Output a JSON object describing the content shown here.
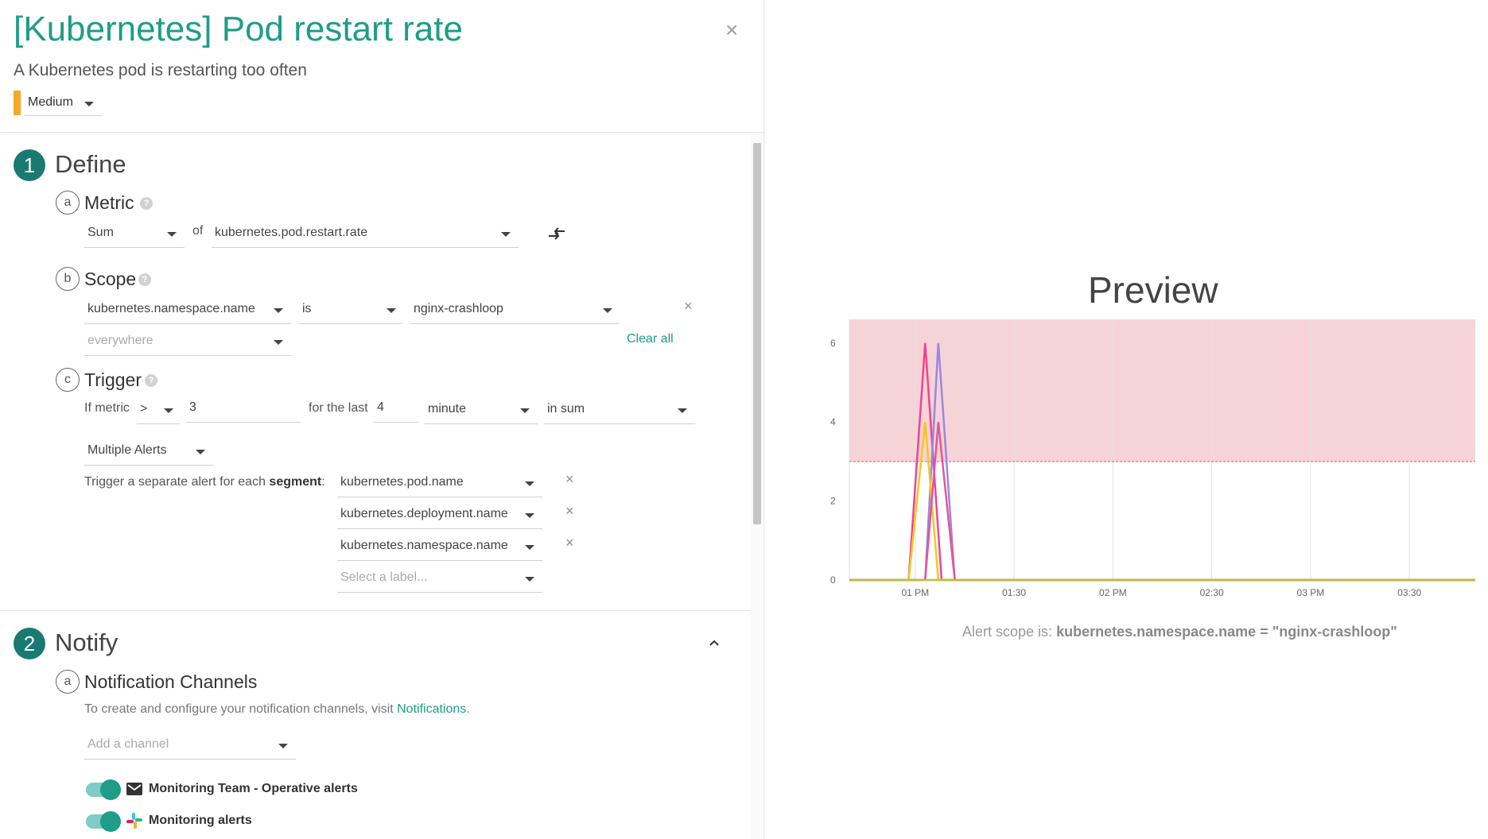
{
  "header": {
    "title": "[Kubernetes] Pod restart rate",
    "subtitle": "A Kubernetes pod is restarting too often",
    "severity": "Medium",
    "severity_color": "#f9a825",
    "close_icon": "close-icon"
  },
  "define": {
    "step_number": "1",
    "title": "Define",
    "metric": {
      "letter": "a",
      "label": "Metric",
      "help": "?",
      "aggregation": "Sum",
      "of_label": "of",
      "metric_name": "kubernetes.pod.restart.rate",
      "swap_icon": "swap-arrows-icon"
    },
    "scope": {
      "letter": "b",
      "label": "Scope",
      "help": "?",
      "key": "kubernetes.namespace.name",
      "operator": "is",
      "value": "nginx-crashloop",
      "second_placeholder": "everywhere",
      "clear_all": "Clear all"
    },
    "trigger": {
      "letter": "c",
      "label": "Trigger",
      "help": "?",
      "if_metric": "If metric",
      "comparator": ">",
      "threshold": "3",
      "for_the_last": "for the last",
      "duration": "4",
      "unit": "minute",
      "aggregation": "in sum",
      "alert_mode": "Multiple Alerts",
      "segment_text_prefix": "Trigger a separate alert for each",
      "segment_text_bold": "segment",
      "segment_text_suffix": ":",
      "segments": [
        "kubernetes.pod.name",
        "kubernetes.deployment.name",
        "kubernetes.namespace.name"
      ],
      "segment_placeholder": "Select a label..."
    }
  },
  "notify": {
    "step_number": "2",
    "title": "Notify",
    "collapse_icon": "chevron-up-icon",
    "channels": {
      "letter": "a",
      "label": "Notification Channels",
      "desc_prefix": "To create and configure your notification channels, visit",
      "desc_link": "Notifications",
      "desc_suffix": ".",
      "add_placeholder": "Add a channel",
      "items": [
        {
          "name": "Monitoring Team - Operative alerts",
          "icon": "email-icon",
          "enabled": true
        },
        {
          "name": "Monitoring alerts",
          "icon": "slack-icon",
          "enabled": true
        }
      ]
    }
  },
  "preview": {
    "title": "Preview",
    "scope_prefix": "Alert scope is:",
    "scope_expr": "kubernetes.namespace.name = \"nginx-crashloop\""
  },
  "chart_data": {
    "type": "line",
    "title": "",
    "x_ticks": [
      "01 PM",
      "01:30",
      "02 PM",
      "02:30",
      "03 PM",
      "03:30"
    ],
    "y_ticks": [
      "0",
      "2",
      "4",
      "6"
    ],
    "ylim": [
      0,
      6.6
    ],
    "xlim": [
      "12:40",
      "03:50"
    ],
    "threshold": 3,
    "alert_region_color": "#f6d3d7",
    "series": [
      {
        "color": "#f0448f",
        "x": [
          "12:40",
          "12:58",
          "01:03",
          "01:08",
          "03:50"
        ],
        "y": [
          0,
          0,
          6,
          0,
          0
        ]
      },
      {
        "color": "#9b87e0",
        "x": [
          "12:40",
          "01:03",
          "01:07",
          "01:12",
          "03:50"
        ],
        "y": [
          0,
          0,
          6,
          0,
          0
        ]
      },
      {
        "color": "#f2c81f",
        "x": [
          "12:40",
          "12:58",
          "01:03",
          "01:07",
          "03:50"
        ],
        "y": [
          0,
          0,
          4,
          0,
          0
        ]
      },
      {
        "color": "#e4569a",
        "x": [
          "12:40",
          "01:03",
          "01:07",
          "01:12",
          "03:50"
        ],
        "y": [
          0,
          0,
          4,
          0,
          0
        ]
      },
      {
        "color": "#b8c13a",
        "x": [
          "12:40",
          "03:50"
        ],
        "y": [
          0,
          0
        ]
      }
    ]
  }
}
